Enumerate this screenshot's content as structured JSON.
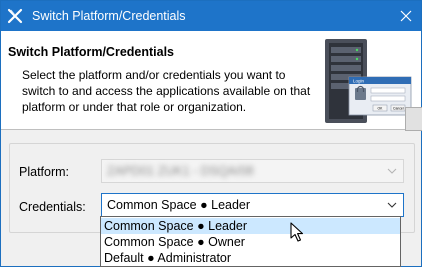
{
  "window": {
    "title": "Switch Platform/Credentials",
    "accent_color": "#1e74c9"
  },
  "header": {
    "heading": "Switch Platform/Credentials",
    "description": "Select the platform and/or credentials you want to switch to and access the applications available on that platform or under that role or organization.",
    "graphic": {
      "icon": "server-login-illustration",
      "login_title": "Login",
      "ok_label": "OK",
      "cancel_label": "Cancel"
    }
  },
  "form": {
    "platform_label": "Platform:",
    "platform_value": "ZAPD01 ZUK1 - DSQA/08",
    "credentials_label": "Credentials:",
    "credentials_value": "Common Space ● Leader"
  },
  "dropdown": {
    "options": [
      "Common Space ● Leader",
      "Common Space ● Owner",
      "Default ● Administrator"
    ],
    "selected_index": 0
  }
}
